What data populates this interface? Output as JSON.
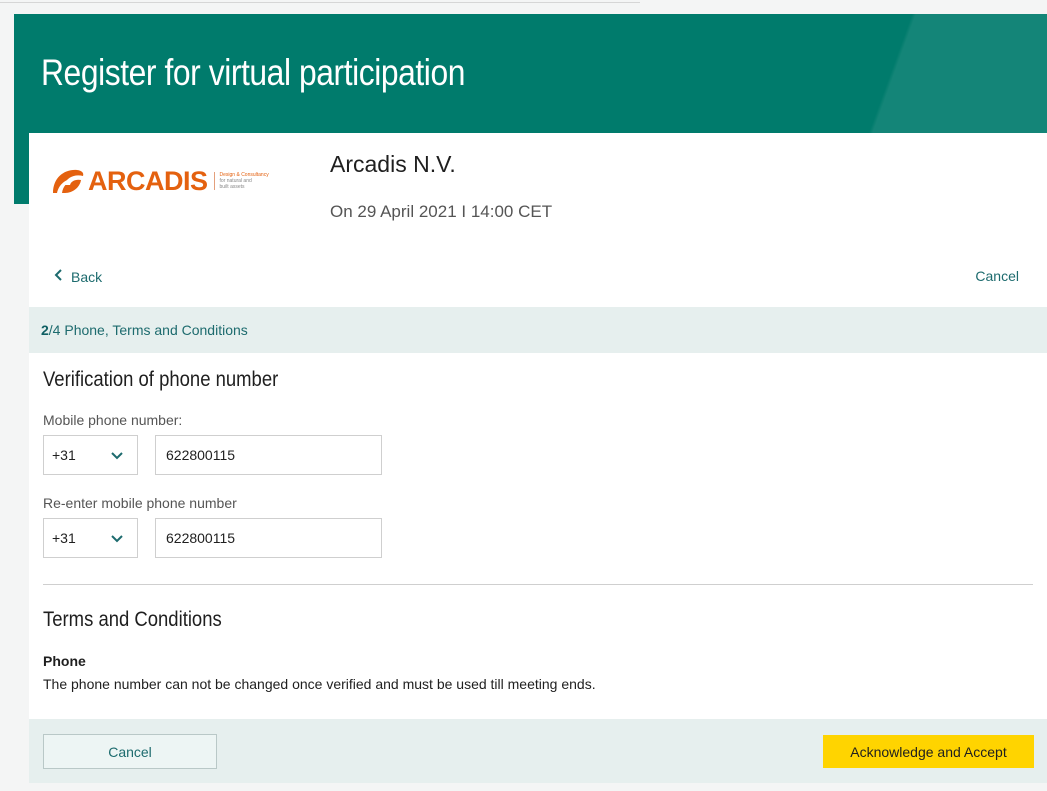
{
  "header": {
    "title": "Register for virtual participation"
  },
  "event": {
    "logo": {
      "text": "ARCADIS",
      "tagline_line1": "Design & Consultancy",
      "tagline_line2": "for natural and",
      "tagline_line3": "built assets"
    },
    "company": "Arcadis N.V.",
    "date": "On 29 April 2021 I 14:00 CET"
  },
  "nav": {
    "back_label": "Back",
    "cancel_label": "Cancel"
  },
  "step": {
    "current": "2",
    "total_label": "/4 Phone, Terms and Conditions"
  },
  "verification": {
    "title": "Verification of phone number",
    "mobile_label": "Mobile phone number:",
    "mobile_country_code": "+31",
    "mobile_value": "622800115",
    "reenter_label": "Re-enter mobile phone number",
    "reenter_country_code": "+31",
    "reenter_value": "622800115"
  },
  "terms": {
    "title": "Terms and Conditions",
    "phone_heading": "Phone",
    "phone_text": "The phone number can not be changed once verified and must be used till meeting ends."
  },
  "footer": {
    "cancel_label": "Cancel",
    "accept_label": "Acknowledge and Accept"
  },
  "colors": {
    "brand_teal": "#007b6c",
    "accent_yellow": "#ffd400",
    "logo_orange": "#e4610f",
    "link_teal": "#1d6b6e"
  }
}
